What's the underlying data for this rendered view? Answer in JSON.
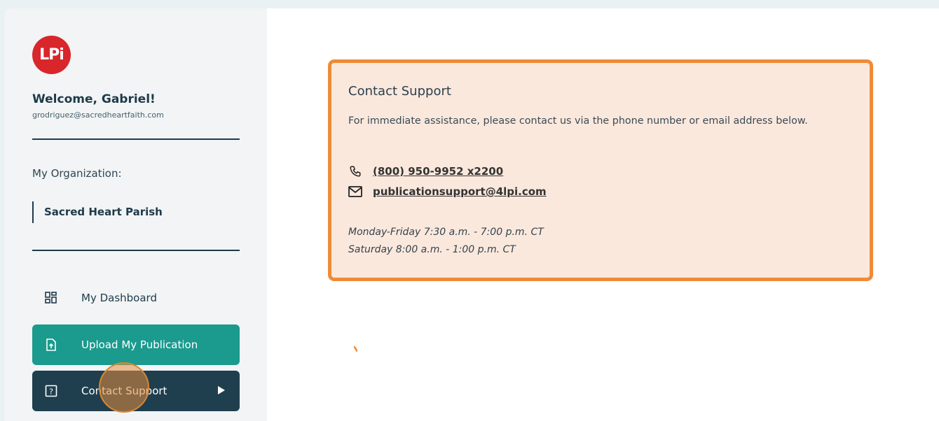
{
  "brand": {
    "logo_text": "LPi",
    "logo_color": "#d8262b"
  },
  "user": {
    "welcome": "Welcome, Gabriel!",
    "email": "grodriguez@sacredheartfaith.com"
  },
  "organization": {
    "label": "My Organization:",
    "name": "Sacred Heart Parish"
  },
  "nav": {
    "dashboard": {
      "label": "My Dashboard",
      "icon": "dashboard-grid-icon"
    },
    "upload": {
      "label": "Upload My Publication",
      "icon": "file-upload-icon",
      "color": "#1b9a8e"
    },
    "contact": {
      "label": "Contact Support",
      "icon": "question-box-icon",
      "color": "#1f3f4f",
      "active": true
    }
  },
  "support_card": {
    "title": "Contact Support",
    "description": "For immediate assistance, please contact us via the phone number or email address below.",
    "phone": "(800) 950-9952 x2200",
    "email": "publicationsupport@4lpi.com",
    "hours_weekday": "Monday-Friday 7:30 a.m. - 7:00 p.m. CT",
    "hours_saturday": "Saturday 8:00 a.m. - 1:00 p.m. CT",
    "border_color": "#ef8b37",
    "background": "#fbe8dd"
  }
}
